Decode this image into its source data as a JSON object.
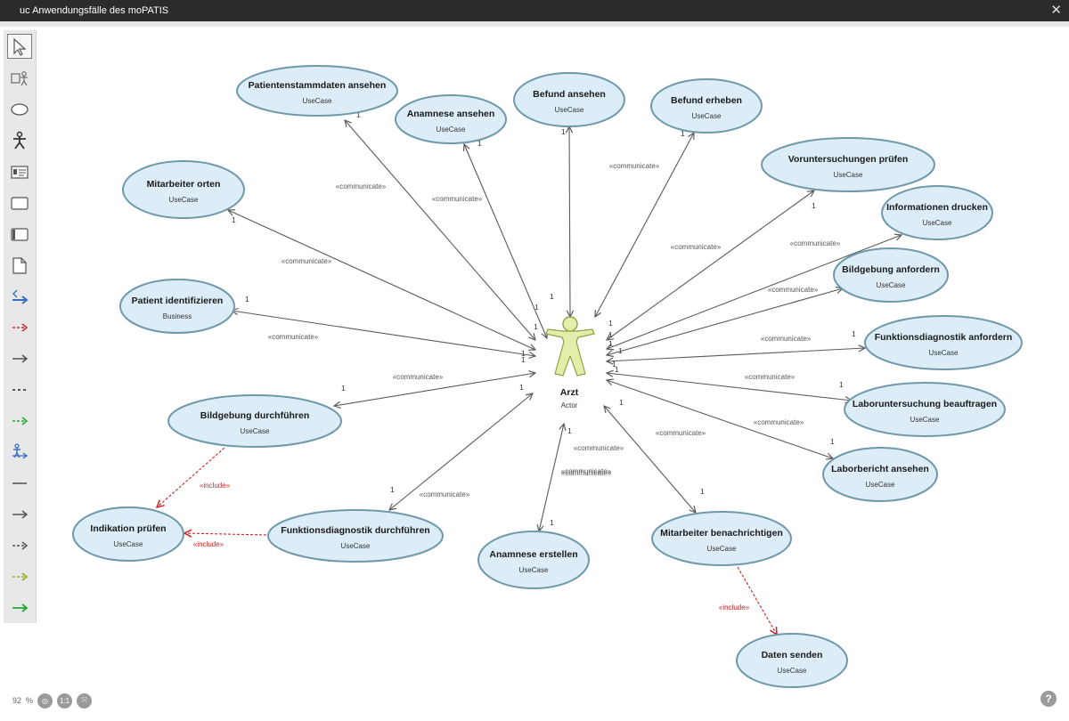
{
  "window": {
    "title": "uc Anwendungsfälle des moPATIS",
    "close_symbol": "✕"
  },
  "toolbar": {
    "tools": [
      {
        "icon": "pointer-icon",
        "color": "#555555"
      },
      {
        "icon": "package-actor-icon",
        "color": "#555555"
      },
      {
        "icon": "usecase-ellipse-icon",
        "color": "#555555"
      },
      {
        "icon": "actor-icon",
        "color": "#333333"
      },
      {
        "icon": "class-card-icon",
        "color": "#555555"
      },
      {
        "icon": "rectangle-icon",
        "color": "#555555"
      },
      {
        "icon": "boundary-icon",
        "color": "#555555"
      },
      {
        "icon": "note-icon",
        "color": "#555555"
      },
      {
        "icon": "blue-arrow-icon",
        "color": "#3a6fc4"
      },
      {
        "icon": "red-dashed-arrow-icon",
        "color": "#cc3333"
      },
      {
        "icon": "gray-arrow-icon",
        "color": "#555555"
      },
      {
        "icon": "dotted-line-icon",
        "color": "#555555"
      },
      {
        "icon": "green-dashed-arrow-icon",
        "color": "#22aa33"
      },
      {
        "icon": "actor-link-icon",
        "color": "#3a6fc4"
      },
      {
        "icon": "line-icon",
        "color": "#555555"
      },
      {
        "icon": "gray-arrow-2-icon",
        "color": "#555555"
      },
      {
        "icon": "gray-dashed-arrow-icon",
        "color": "#555555"
      },
      {
        "icon": "olive-arrow-icon",
        "color": "#99aa22"
      },
      {
        "icon": "green-arrow-icon",
        "color": "#22aa33"
      }
    ]
  },
  "diagram": {
    "colors": {
      "usecase_fill": "#dcedf7",
      "usecase_stroke": "#6f98aa",
      "actor_fill": "#e3eeaa",
      "actor_stroke": "#8fa24a",
      "line": "#5a5a5a",
      "include": "#cc2222"
    },
    "actor": {
      "name": "Arzt",
      "stereotype": "Actor"
    },
    "usecases": [
      {
        "id": "u1",
        "name": "Patientenstammdaten ansehen",
        "stereotype": "UseCase"
      },
      {
        "id": "u2",
        "name": "Anamnese ansehen",
        "stereotype": "UseCase"
      },
      {
        "id": "u3",
        "name": "Befund ansehen",
        "stereotype": "UseCase"
      },
      {
        "id": "u4",
        "name": "Befund erheben",
        "stereotype": "UseCase"
      },
      {
        "id": "u5",
        "name": "Voruntersuchungen prüfen",
        "stereotype": "UseCase"
      },
      {
        "id": "u6",
        "name": "Informationen drucken",
        "stereotype": "UseCase"
      },
      {
        "id": "u7",
        "name": "Mitarbeiter orten",
        "stereotype": "UseCase"
      },
      {
        "id": "u8",
        "name": "Bildgebung anfordern",
        "stereotype": "UseCase"
      },
      {
        "id": "u9",
        "name": "Patient identifizieren",
        "stereotype": "Business"
      },
      {
        "id": "u10",
        "name": "Funktionsdiagnostik anfordern",
        "stereotype": "UseCase"
      },
      {
        "id": "u11",
        "name": "Laboruntersuchung beauftragen",
        "stereotype": "UseCase"
      },
      {
        "id": "u12",
        "name": "Bildgebung durchführen",
        "stereotype": "UseCase"
      },
      {
        "id": "u13",
        "name": "Laborbericht ansehen",
        "stereotype": "UseCase"
      },
      {
        "id": "u14",
        "name": "Indikation prüfen",
        "stereotype": "UseCase"
      },
      {
        "id": "u15",
        "name": "Funktionsdiagnostik durchführen",
        "stereotype": "UseCase"
      },
      {
        "id": "u16",
        "name": "Anamnese erstellen",
        "stereotype": "UseCase"
      },
      {
        "id": "u17",
        "name": "Mitarbeiter benachrichtigen",
        "stereotype": "UseCase"
      },
      {
        "id": "u18",
        "name": "Daten senden",
        "stereotype": "UseCase"
      }
    ],
    "associations": [
      {
        "target": "u1",
        "label": "«communicate»",
        "mult_actor": "1",
        "mult_uc": "1"
      },
      {
        "target": "u2",
        "label": "«communicate»",
        "mult_actor": "1",
        "mult_uc": "1"
      },
      {
        "target": "u3",
        "label": "",
        "mult_actor": "",
        "mult_uc": "1"
      },
      {
        "target": "u4",
        "label": "«communicate»",
        "mult_actor": "",
        "mult_uc": "1"
      },
      {
        "target": "u5",
        "label": "«communicate»",
        "mult_actor": "1",
        "mult_uc": "1"
      },
      {
        "target": "u6",
        "label": "«communicate»",
        "mult_actor": "1",
        "mult_uc": "1"
      },
      {
        "target": "u7",
        "label": "«communicate»",
        "mult_actor": "1",
        "mult_uc": "1"
      },
      {
        "target": "u8",
        "label": "«communicate»",
        "mult_actor": "1",
        "mult_uc": "1"
      },
      {
        "target": "u9",
        "label": "«communicate»",
        "mult_actor": "1",
        "mult_uc": "1"
      },
      {
        "target": "u10",
        "label": "«communicate»",
        "mult_actor": "1",
        "mult_uc": "1"
      },
      {
        "target": "u11",
        "label": "«communicate»",
        "mult_actor": "1",
        "mult_uc": "1"
      },
      {
        "target": "u12",
        "label": "«communicate»",
        "mult_actor": "1",
        "mult_uc": "1"
      },
      {
        "target": "u13",
        "label": "«communicate»",
        "mult_actor": "1",
        "mult_uc": "1"
      },
      {
        "target": "u15",
        "label": "«communicate»",
        "mult_actor": "1",
        "mult_uc": "1"
      },
      {
        "target": "u16",
        "label": "«communicate»",
        "mult_actor": "1",
        "mult_uc": "1"
      },
      {
        "target": "u17",
        "label": "«communicate»",
        "mult_actor": "1",
        "mult_uc": "1"
      }
    ],
    "extra_labels": [
      "«communicate»",
      "«communicate»"
    ],
    "includes": [
      {
        "from": "u12",
        "to": "u14",
        "label": "«include»"
      },
      {
        "from": "u15",
        "to": "u14",
        "label": "«include»"
      },
      {
        "from": "u17",
        "to": "u18",
        "label": "«include»"
      }
    ]
  },
  "zoom": {
    "value": "92",
    "unit": "%",
    "fit_label": "1:1"
  },
  "help": {
    "symbol": "?"
  }
}
